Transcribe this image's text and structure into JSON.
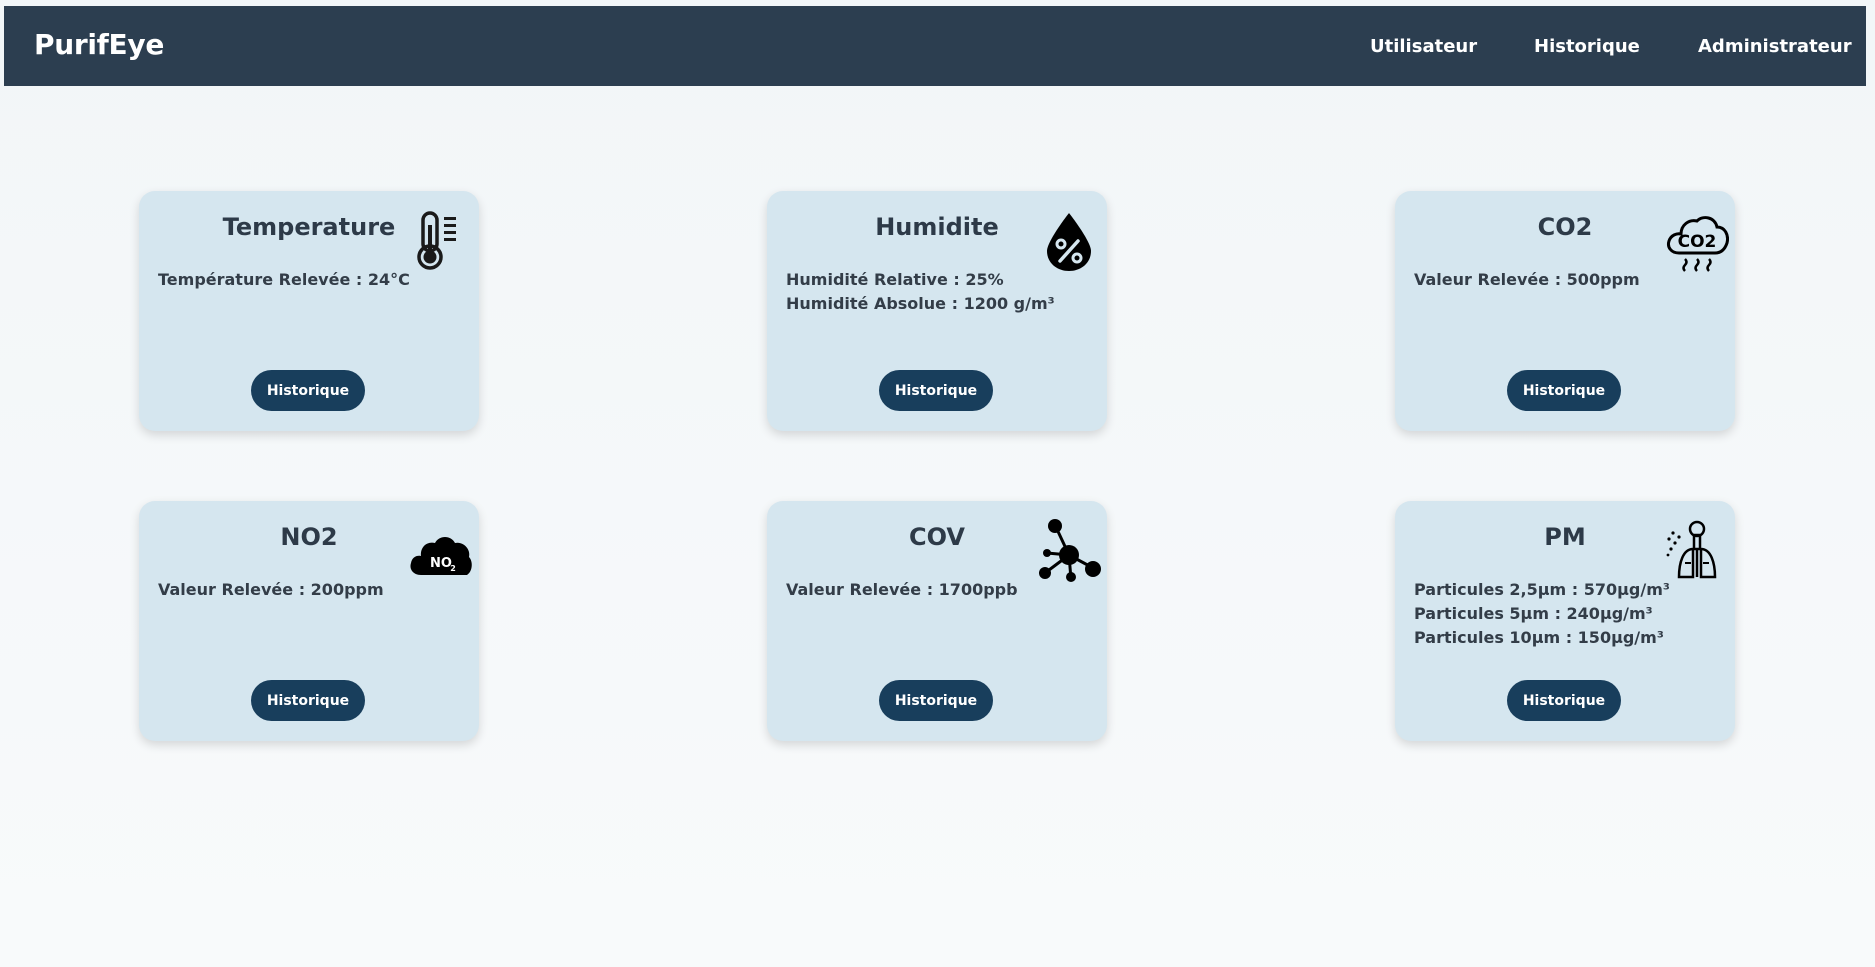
{
  "app": {
    "brand": "PurifEye"
  },
  "nav": {
    "items": [
      {
        "label": "Utilisateur"
      },
      {
        "label": "Historique"
      },
      {
        "label": "Administrateur"
      }
    ]
  },
  "cards": [
    {
      "title": "Temperature",
      "icon": "thermometer-icon",
      "readings": [
        "Température Relevée : 24°C"
      ],
      "button": "Historique"
    },
    {
      "title": "Humidite",
      "icon": "humidity-drop-icon",
      "readings": [
        "Humidité Relative : 25%",
        "Humidité Absolue : 1200 g/m³"
      ],
      "button": "Historique"
    },
    {
      "title": "CO2",
      "icon": "co2-cloud-icon",
      "readings": [
        "Valeur Relevée : 500ppm"
      ],
      "button": "Historique"
    },
    {
      "title": "NO2",
      "icon": "no2-cloud-icon",
      "icon_text": "NO",
      "icon_subscript": "2",
      "readings": [
        "Valeur Relevée : 200ppm"
      ],
      "button": "Historique"
    },
    {
      "title": "COV",
      "icon": "molecule-icon",
      "readings": [
        "Valeur Relevée : 1700ppb"
      ],
      "button": "Historique"
    },
    {
      "title": "PM",
      "icon": "lungs-particles-icon",
      "readings": [
        "Particules 2,5μm : 570μg/m³",
        "Particules 5μm : 240μg/m³",
        "Particules 10μm : 150μg/m³"
      ],
      "button": "Historique"
    }
  ],
  "colors": {
    "navbar": "#2c3e50",
    "card": "#d5e6ef",
    "button": "#183e5c",
    "text": "#2d3a48"
  }
}
